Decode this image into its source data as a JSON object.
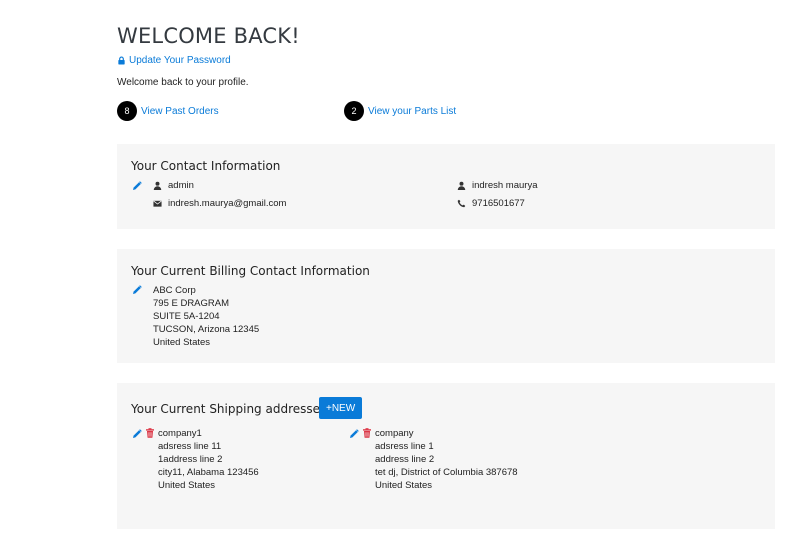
{
  "header": {
    "title": "WELCOME BACK!",
    "update_password": "Update Your Password",
    "welcome_text": "Welcome back to your profile."
  },
  "links": {
    "past_orders": {
      "count": "8",
      "label": "View Past Orders"
    },
    "parts_list": {
      "count": "2",
      "label": "View your Parts List"
    }
  },
  "contact": {
    "title": "Your Contact Information",
    "username": "admin",
    "email": "indresh.maurya@gmail.com",
    "full_name": "indresh maurya",
    "phone": "9716501677"
  },
  "billing": {
    "title": "Your Current Billing Contact Information",
    "lines": [
      "ABC Corp",
      "795 E DRAGRAM",
      "SUITE 5A-1204",
      "TUCSON, Arizona 12345",
      "United States"
    ]
  },
  "shipping": {
    "title": "Your Current Shipping addresses",
    "new_button": "+NEW",
    "addresses": [
      {
        "name": "company1",
        "lines": [
          "adsress line 11",
          "1address line 2",
          "city11, Alabama 123456",
          "United States"
        ]
      },
      {
        "name": "company",
        "lines": [
          "adsress line 1",
          "address line 2",
          "tet dj, District of Columbia 387678",
          "United States"
        ]
      }
    ]
  },
  "colors": {
    "link": "#0a7bd8",
    "delete": "#dc3545",
    "card_bg": "#f6f6f6"
  }
}
